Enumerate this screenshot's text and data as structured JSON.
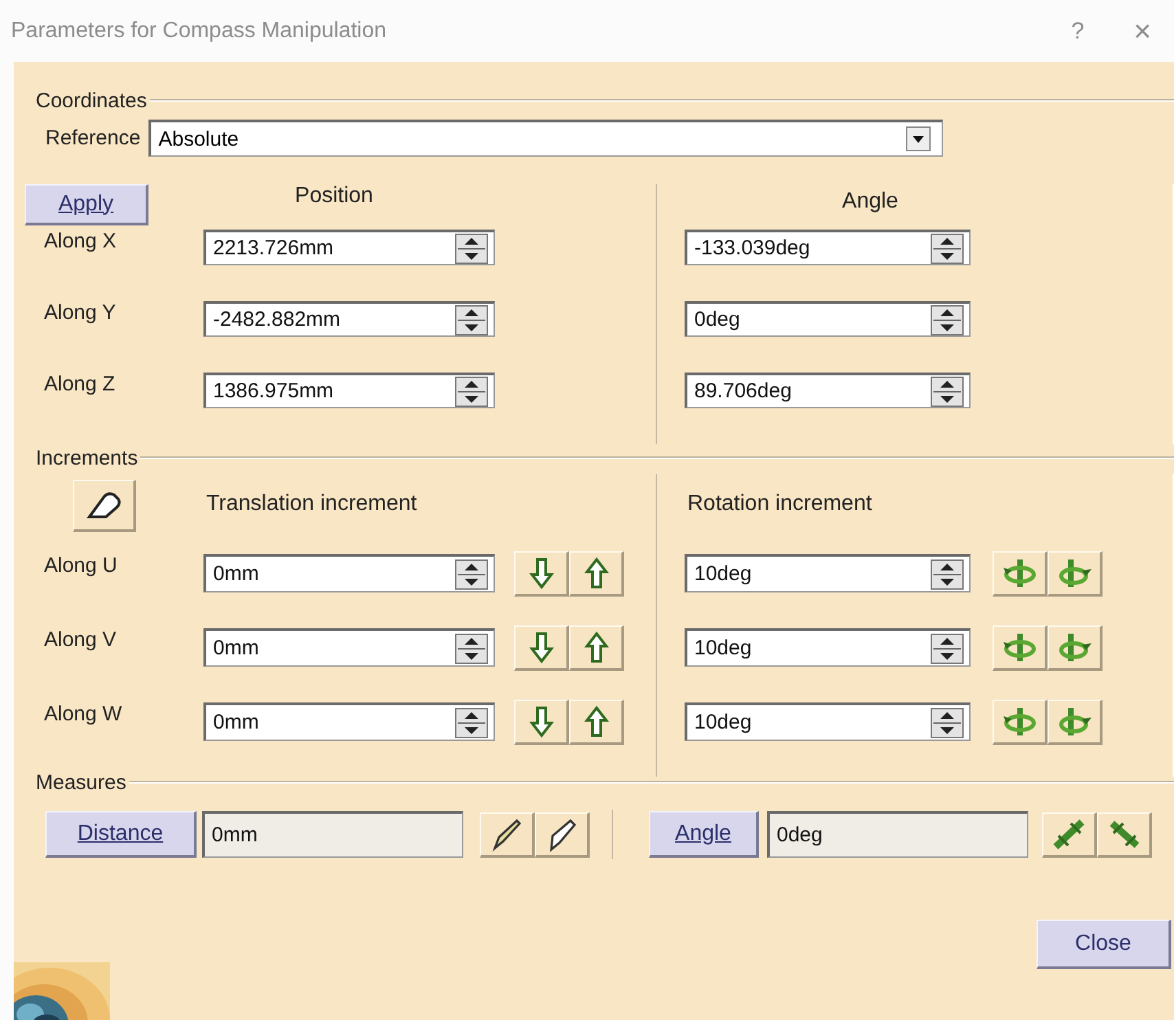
{
  "window": {
    "title": "Parameters for Compass Manipulation",
    "help": "?",
    "close": "×"
  },
  "coordinates": {
    "legend": "Coordinates",
    "reference_label": "Reference",
    "reference": "Absolute",
    "apply": "Apply",
    "position_header": "Position",
    "angle_header": "Angle",
    "rows": [
      {
        "label": "Along X",
        "position": "2213.726mm",
        "angle": "-133.039deg"
      },
      {
        "label": "Along Y",
        "position": "-2482.882mm",
        "angle": "0deg"
      },
      {
        "label": "Along Z",
        "position": "1386.975mm",
        "angle": "89.706deg"
      }
    ]
  },
  "increments": {
    "legend": "Increments",
    "translation_header": "Translation increment",
    "rotation_header": "Rotation increment",
    "rows": [
      {
        "label": "Along U",
        "translation": "0mm",
        "rotation": "10deg"
      },
      {
        "label": "Along V",
        "translation": "0mm",
        "rotation": "10deg"
      },
      {
        "label": "Along W",
        "translation": "0mm",
        "rotation": "10deg"
      }
    ]
  },
  "measures": {
    "legend": "Measures",
    "distance_button": "Distance",
    "distance": "0mm",
    "angle_button": "Angle",
    "angle": "0deg"
  },
  "close_button": "Close"
}
